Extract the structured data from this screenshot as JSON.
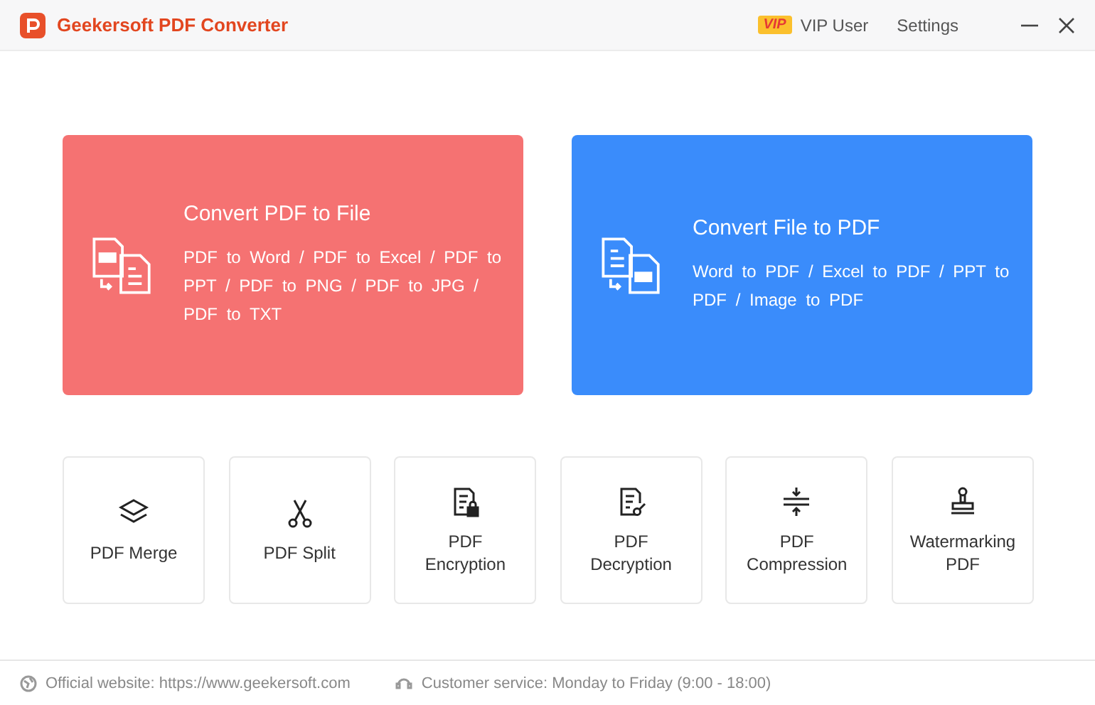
{
  "app": {
    "title": "Geekersoft PDF Converter"
  },
  "header": {
    "vip_badge": "VIP",
    "vip_label": "VIP User",
    "settings": "Settings"
  },
  "cards": [
    {
      "kind": "from_pdf",
      "color": "#f57272",
      "title": "Convert PDF to File",
      "options": "PDF to Word / PDF to Excel / PDF to PPT / PDF to PNG / PDF to JPG / PDF to TXT"
    },
    {
      "kind": "to_pdf",
      "color": "#3a8cfb",
      "title": "Convert File to PDF",
      "options": "Word to PDF / Excel to PDF / PPT to PDF / Image to PDF"
    }
  ],
  "tools": [
    {
      "kind": "merge",
      "label": "PDF Merge"
    },
    {
      "kind": "split",
      "label": "PDF Split"
    },
    {
      "kind": "encrypt",
      "label": "PDF Encryption"
    },
    {
      "kind": "decrypt",
      "label": "PDF Decryption"
    },
    {
      "kind": "compress",
      "label": "PDF Compression"
    },
    {
      "kind": "watermark",
      "label": "Watermarking PDF"
    }
  ],
  "footer": {
    "website": "Official website: https://www.geekersoft.com",
    "service": "Customer service: Monday to Friday (9:00 - 18:00)"
  }
}
